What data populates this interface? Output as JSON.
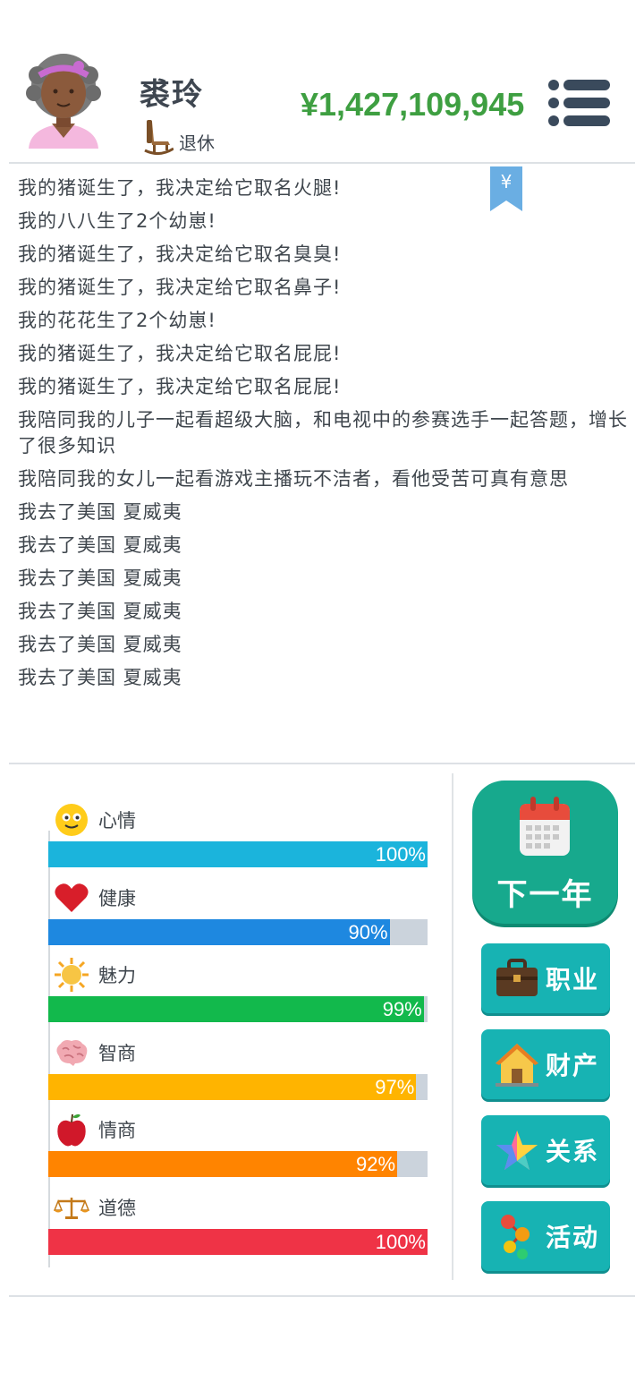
{
  "player": {
    "name": "裘玲",
    "status": "退休",
    "money": "¥1,427,109,945"
  },
  "bookmark_symbol": "¥",
  "log": [
    "我的猪诞生了，我决定给它取名火腿!",
    "我的八八生了2个幼崽!",
    "我的猪诞生了，我决定给它取名臭臭!",
    "我的猪诞生了，我决定给它取名鼻子!",
    "我的花花生了2个幼崽!",
    "我的猪诞生了，我决定给它取名屁屁!",
    "我的猪诞生了，我决定给它取名屁屁!",
    "我陪同我的儿子一起看超级大脑，和电视中的参赛选手一起答题，增长了很多知识",
    "我陪同我的女儿一起看游戏主播玩不洁者，看他受苦可真有意思",
    "我去了美国 夏威夷",
    "我去了美国 夏威夷",
    "我去了美国 夏威夷",
    "我去了美国 夏威夷",
    "我去了美国 夏威夷",
    "我去了美国 夏威夷"
  ],
  "stats": [
    {
      "label": "心情",
      "value": 100,
      "text": "100%",
      "color": "#1bb4dc",
      "icon": "smiley-icon"
    },
    {
      "label": "健康",
      "value": 90,
      "text": "90%",
      "color": "#1e88e0",
      "icon": "heart-icon"
    },
    {
      "label": "魅力",
      "value": 99,
      "text": "99%",
      "color": "#12b94c",
      "icon": "sun-icon"
    },
    {
      "label": "智商",
      "value": 97,
      "text": "97%",
      "color": "#ffb400",
      "icon": "brain-icon"
    },
    {
      "label": "情商",
      "value": 92,
      "text": "92%",
      "color": "#ff8400",
      "icon": "apple-icon"
    },
    {
      "label": "道德",
      "value": 100,
      "text": "100%",
      "color": "#ef3346",
      "icon": "scales-icon"
    }
  ],
  "actions": {
    "next_year": "下一年",
    "career": "职业",
    "property": "财产",
    "relationship": "关系",
    "activity": "活动"
  },
  "colors": {
    "money": "#3e9f41",
    "button_teal": "#17b3b3",
    "next_year_green": "#17a98d",
    "track": "#cbd3dc"
  }
}
